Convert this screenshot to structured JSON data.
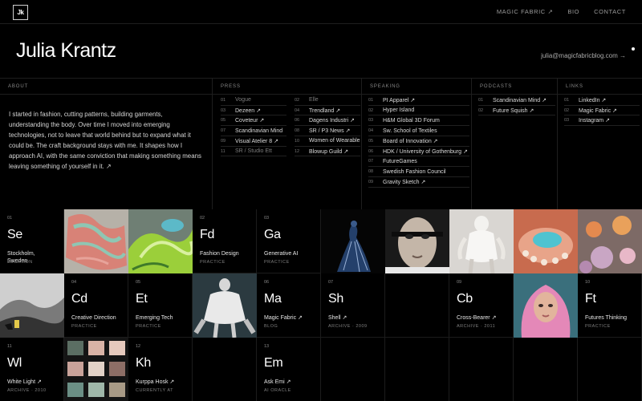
{
  "logo": "Jk",
  "nav": {
    "magic": "MAGIC FABRIC ↗",
    "bio": "BIO",
    "contact": "CONTACT"
  },
  "hero": {
    "name": "Julia Krantz",
    "email": "julia@magicfabricblog.com →"
  },
  "about": {
    "heading": "ABOUT",
    "text": "I started in fashion, cutting patterns, building garments, understanding the body. Over time I moved into emerging technologies, not to leave that world behind but to expand what it could be. The craft background stays with me. It shapes how I approach AI, with the same conviction that making something means leaving something of yourself in it. ↗"
  },
  "press": {
    "heading": "PRESS",
    "left": [
      {
        "n": "01",
        "t": "Vogue"
      },
      {
        "n": "03",
        "t": "Dezeen ↗"
      },
      {
        "n": "05",
        "t": "Coveteur ↗"
      },
      {
        "n": "07",
        "t": "Scandinavian Mind"
      },
      {
        "n": "09",
        "t": "Visual Atelier 8 ↗"
      },
      {
        "n": "11",
        "t": "SR / Studio Ett"
      }
    ],
    "right": [
      {
        "n": "02",
        "t": "Elle"
      },
      {
        "n": "04",
        "t": "Trendland ↗"
      },
      {
        "n": "06",
        "t": "Dagens Industri ↗"
      },
      {
        "n": "08",
        "t": "SR / P3 News ↗"
      },
      {
        "n": "10",
        "t": "Women of Wearable"
      },
      {
        "n": "12",
        "t": "Blowup Guild ↗"
      }
    ]
  },
  "speaking": {
    "heading": "SPEAKING",
    "items": [
      {
        "n": "01",
        "t": "PI Apparel ↗"
      },
      {
        "n": "02",
        "t": "Hyper Island"
      },
      {
        "n": "03",
        "t": "H&M Global 3D Forum"
      },
      {
        "n": "04",
        "t": "Sw. School of Textiles"
      },
      {
        "n": "05",
        "t": "Board of Innovation ↗"
      },
      {
        "n": "06",
        "t": "HDK / University of Gothenburg ↗"
      },
      {
        "n": "07",
        "t": "FutureGames"
      },
      {
        "n": "08",
        "t": "Swedish Fashion Council"
      },
      {
        "n": "09",
        "t": "Gravity Sketch ↗"
      }
    ]
  },
  "podcasts": {
    "heading": "PODCASTS",
    "items": [
      {
        "n": "01",
        "t": "Scandinavian Mind ↗"
      },
      {
        "n": "02",
        "t": "Future Squish ↗"
      }
    ]
  },
  "links": {
    "heading": "LINKS",
    "items": [
      {
        "n": "01",
        "t": "LinkedIn ↗"
      },
      {
        "n": "02",
        "t": "Magic Fabric ↗"
      },
      {
        "n": "03",
        "t": "Instagram ↗"
      }
    ]
  },
  "elements": [
    {
      "num": "01",
      "sym": "Se",
      "name": "Stockholm,",
      "name2": "Sweden",
      "cat": "LOCATION"
    },
    {
      "num": "02",
      "sym": "Fd",
      "name": "Fashion Design",
      "cat": "PRACTICE"
    },
    {
      "num": "03",
      "sym": "Ga",
      "name": "Generative AI",
      "cat": "PRACTICE"
    },
    {
      "num": "04",
      "sym": "Cd",
      "name": "Creative Direction",
      "cat": "PRACTICE"
    },
    {
      "num": "05",
      "sym": "Et",
      "name": "Emerging Tech",
      "cat": "PRACTICE"
    },
    {
      "num": "06",
      "sym": "Ma",
      "name": "Magic Fabric ↗",
      "cat": "BLOG"
    },
    {
      "num": "07",
      "sym": "Sh",
      "name": "Shell ↗",
      "cat": "ARCHIVE · 2009"
    },
    {
      "num": "09",
      "sym": "Cb",
      "name": "Cross-Bearer ↗",
      "cat": "ARCHIVE · 2011"
    },
    {
      "num": "10",
      "sym": "Ft",
      "name": "Futures Thinking",
      "cat": "PRACTICE"
    },
    {
      "num": "11",
      "sym": "Wl",
      "name": "White Light ↗",
      "cat": "ARCHIVE · 2010"
    },
    {
      "num": "12",
      "sym": "Kh",
      "name": "Kurppa Hosk ↗",
      "cat": "CURRENTLY AT"
    },
    {
      "num": "13",
      "sym": "Em",
      "name": "Ask Emi ↗",
      "cat": "AI ORACLE"
    }
  ],
  "colors": {
    "background": "#000000",
    "text": "#ffffff",
    "muted": "#888888",
    "border": "#1e1e1e"
  }
}
